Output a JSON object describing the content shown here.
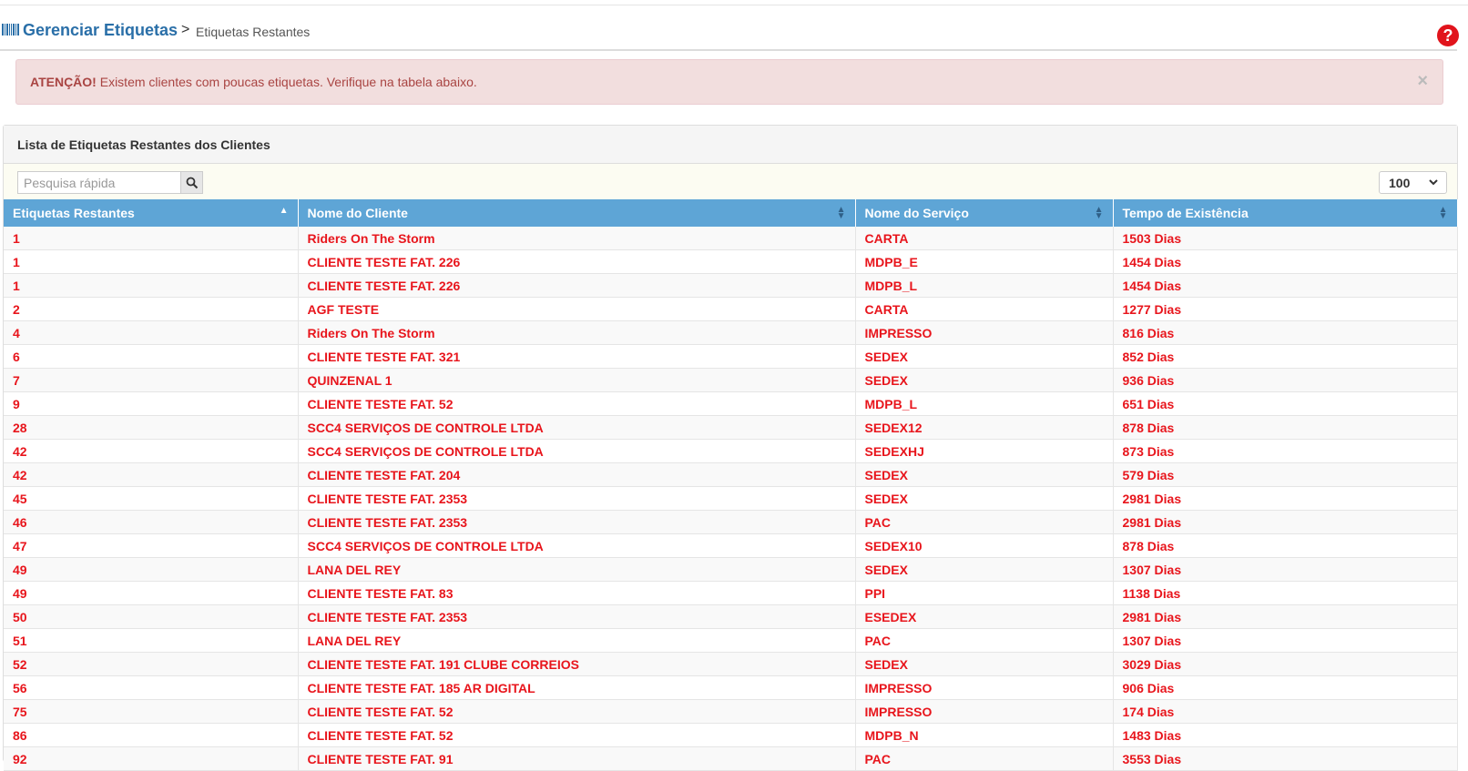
{
  "header": {
    "title": "Gerenciar Etiquetas",
    "separator": ">",
    "subtitle": "Etiquetas Restantes",
    "help_label": "?"
  },
  "alert": {
    "strong": "ATENÇÃO!",
    "message": " Existem clientes com poucas etiquetas. Verifique na tabela abaixo.",
    "close": "×"
  },
  "panel": {
    "title": "Lista de Etiquetas Restantes dos Clientes"
  },
  "search": {
    "placeholder": "Pesquisa rápida"
  },
  "page_size": {
    "selected": "100"
  },
  "table": {
    "columns": [
      "Etiquetas Restantes",
      "Nome do Cliente",
      "Nome do Serviço",
      "Tempo de Existência"
    ],
    "rows": [
      [
        "1",
        "Riders On The Storm",
        "CARTA",
        "1503 Dias"
      ],
      [
        "1",
        "CLIENTE TESTE FAT. 226",
        "MDPB_E",
        "1454 Dias"
      ],
      [
        "1",
        "CLIENTE TESTE FAT. 226",
        "MDPB_L",
        "1454 Dias"
      ],
      [
        "2",
        "AGF TESTE",
        "CARTA",
        "1277 Dias"
      ],
      [
        "4",
        "Riders On The Storm",
        "IMPRESSO",
        "816 Dias"
      ],
      [
        "6",
        "CLIENTE TESTE FAT. 321",
        "SEDEX",
        "852 Dias"
      ],
      [
        "7",
        "QUINZENAL 1",
        "SEDEX",
        "936 Dias"
      ],
      [
        "9",
        "CLIENTE TESTE FAT. 52",
        "MDPB_L",
        "651 Dias"
      ],
      [
        "28",
        "SCC4 SERVIÇOS DE CONTROLE LTDA",
        "SEDEX12",
        "878 Dias"
      ],
      [
        "42",
        "SCC4 SERVIÇOS DE CONTROLE LTDA",
        "SEDEXHJ",
        "873 Dias"
      ],
      [
        "42",
        "CLIENTE TESTE FAT. 204",
        "SEDEX",
        "579 Dias"
      ],
      [
        "45",
        "CLIENTE TESTE FAT. 2353",
        "SEDEX",
        "2981 Dias"
      ],
      [
        "46",
        "CLIENTE TESTE FAT. 2353",
        "PAC",
        "2981 Dias"
      ],
      [
        "47",
        "SCC4 SERVIÇOS DE CONTROLE LTDA",
        "SEDEX10",
        "878 Dias"
      ],
      [
        "49",
        "LANA DEL REY",
        "SEDEX",
        "1307 Dias"
      ],
      [
        "49",
        "CLIENTE TESTE FAT. 83",
        "PPI",
        "1138 Dias"
      ],
      [
        "50",
        "CLIENTE TESTE FAT. 2353",
        "ESEDEX",
        "2981 Dias"
      ],
      [
        "51",
        "LANA DEL REY",
        "PAC",
        "1307 Dias"
      ],
      [
        "52",
        "CLIENTE TESTE FAT. 191 CLUBE CORREIOS",
        "SEDEX",
        "3029 Dias"
      ],
      [
        "56",
        "CLIENTE TESTE FAT. 185 AR DIGITAL",
        "IMPRESSO",
        "906 Dias"
      ],
      [
        "75",
        "CLIENTE TESTE FAT. 52",
        "IMPRESSO",
        "174 Dias"
      ],
      [
        "86",
        "CLIENTE TESTE FAT. 52",
        "MDPB_N",
        "1483 Dias"
      ],
      [
        "92",
        "CLIENTE TESTE FAT. 91",
        "PAC",
        "3553 Dias"
      ]
    ]
  },
  "icons": {
    "barcode": "barcode-icon",
    "help": "question-circle-icon",
    "search": "search-icon",
    "sort": "sort-icon",
    "close": "close-icon",
    "chevron": "chevron-down-icon"
  },
  "colors": {
    "title_blue": "#2a6fa8",
    "header_blue": "#5ea5d6",
    "row_text_red": "#e8151c",
    "alert_bg": "#f2dede",
    "alert_text": "#a94442"
  }
}
